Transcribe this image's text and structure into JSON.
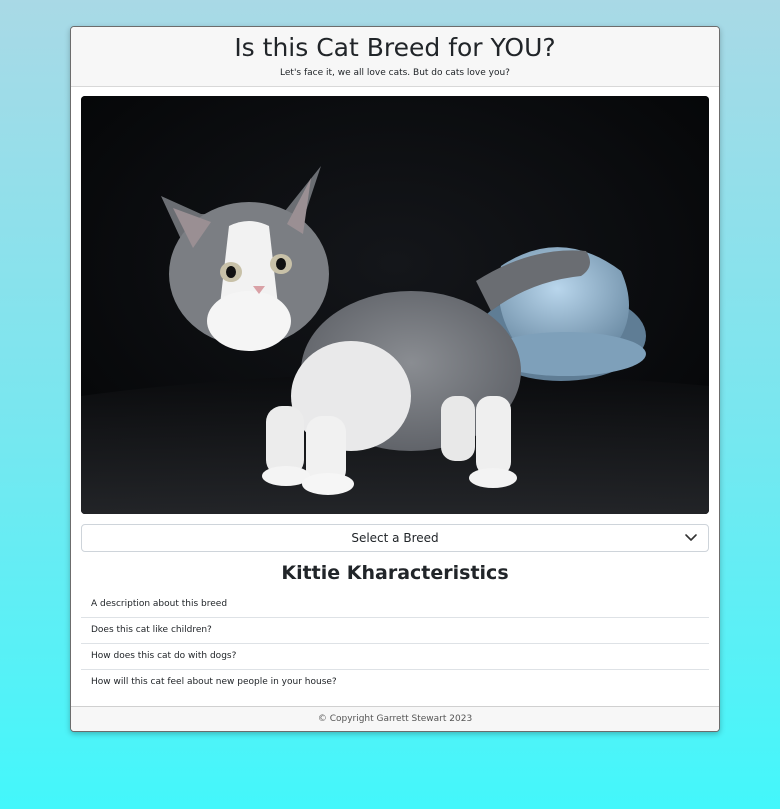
{
  "header": {
    "title": "Is this Cat Breed for YOU?",
    "subtitle": "Let's face it, we all love cats. But do cats love you?"
  },
  "photo": {
    "subject": "grey-and-white-kitten"
  },
  "breed_select": {
    "selected": "Select a Breed",
    "icon": "chevron-down-icon"
  },
  "characteristics": {
    "title": "Kittie Kharacteristics",
    "items": [
      "A description about this breed",
      "Does this cat like children?",
      "How does this cat do with dogs?",
      "How will this cat feel about new people in your house?"
    ]
  },
  "footer": {
    "copyright": "© Copyright Garrett Stewart 2023"
  },
  "colors": {
    "background_top": "#a9d9e6",
    "background_bottom": "#43f7fb",
    "card_header": "#f7f7f7"
  }
}
